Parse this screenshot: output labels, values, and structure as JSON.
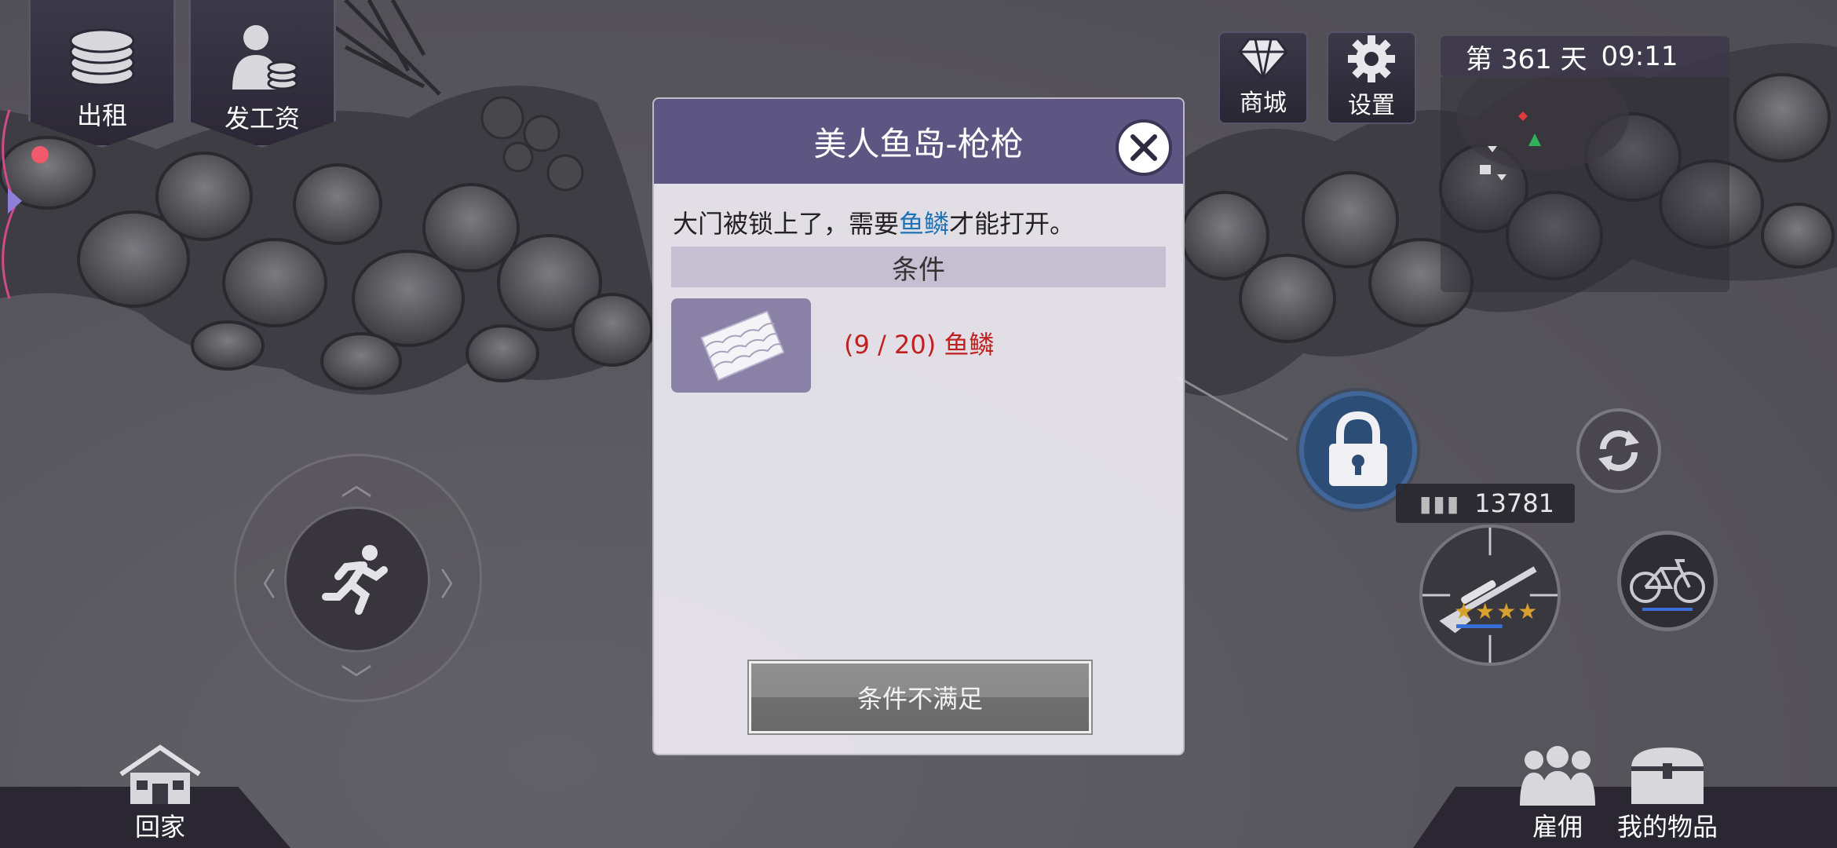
{
  "top_left": {
    "rent_label": "出租",
    "pay_label": "发工资"
  },
  "top_right": {
    "shop_label": "商城",
    "settings_label": "设置",
    "day_prefix": "第",
    "day_number": "361",
    "day_suffix": "天",
    "time": "09:11"
  },
  "combat": {
    "ammo_count": "13781",
    "weapon_stars": "★★★★"
  },
  "bottom": {
    "home_label": "回家",
    "hire_label": "雇佣",
    "items_label": "我的物品"
  },
  "dialog": {
    "title": "美人鱼岛-枪枪",
    "message_before": "大门被锁上了，需要",
    "message_highlight": "鱼鳞",
    "message_after": "才能打开。",
    "conditions_header": "条件",
    "requirement_text": "(9 / 20) 鱼鳞",
    "requirement_icon": "fish-scale-icon",
    "button_label": "条件不满足"
  },
  "colors": {
    "dialog_header": "#5e5682",
    "highlight": "#1f72b5",
    "requirement_unmet": "#c0201f",
    "lock_button": "#2c4e76"
  }
}
